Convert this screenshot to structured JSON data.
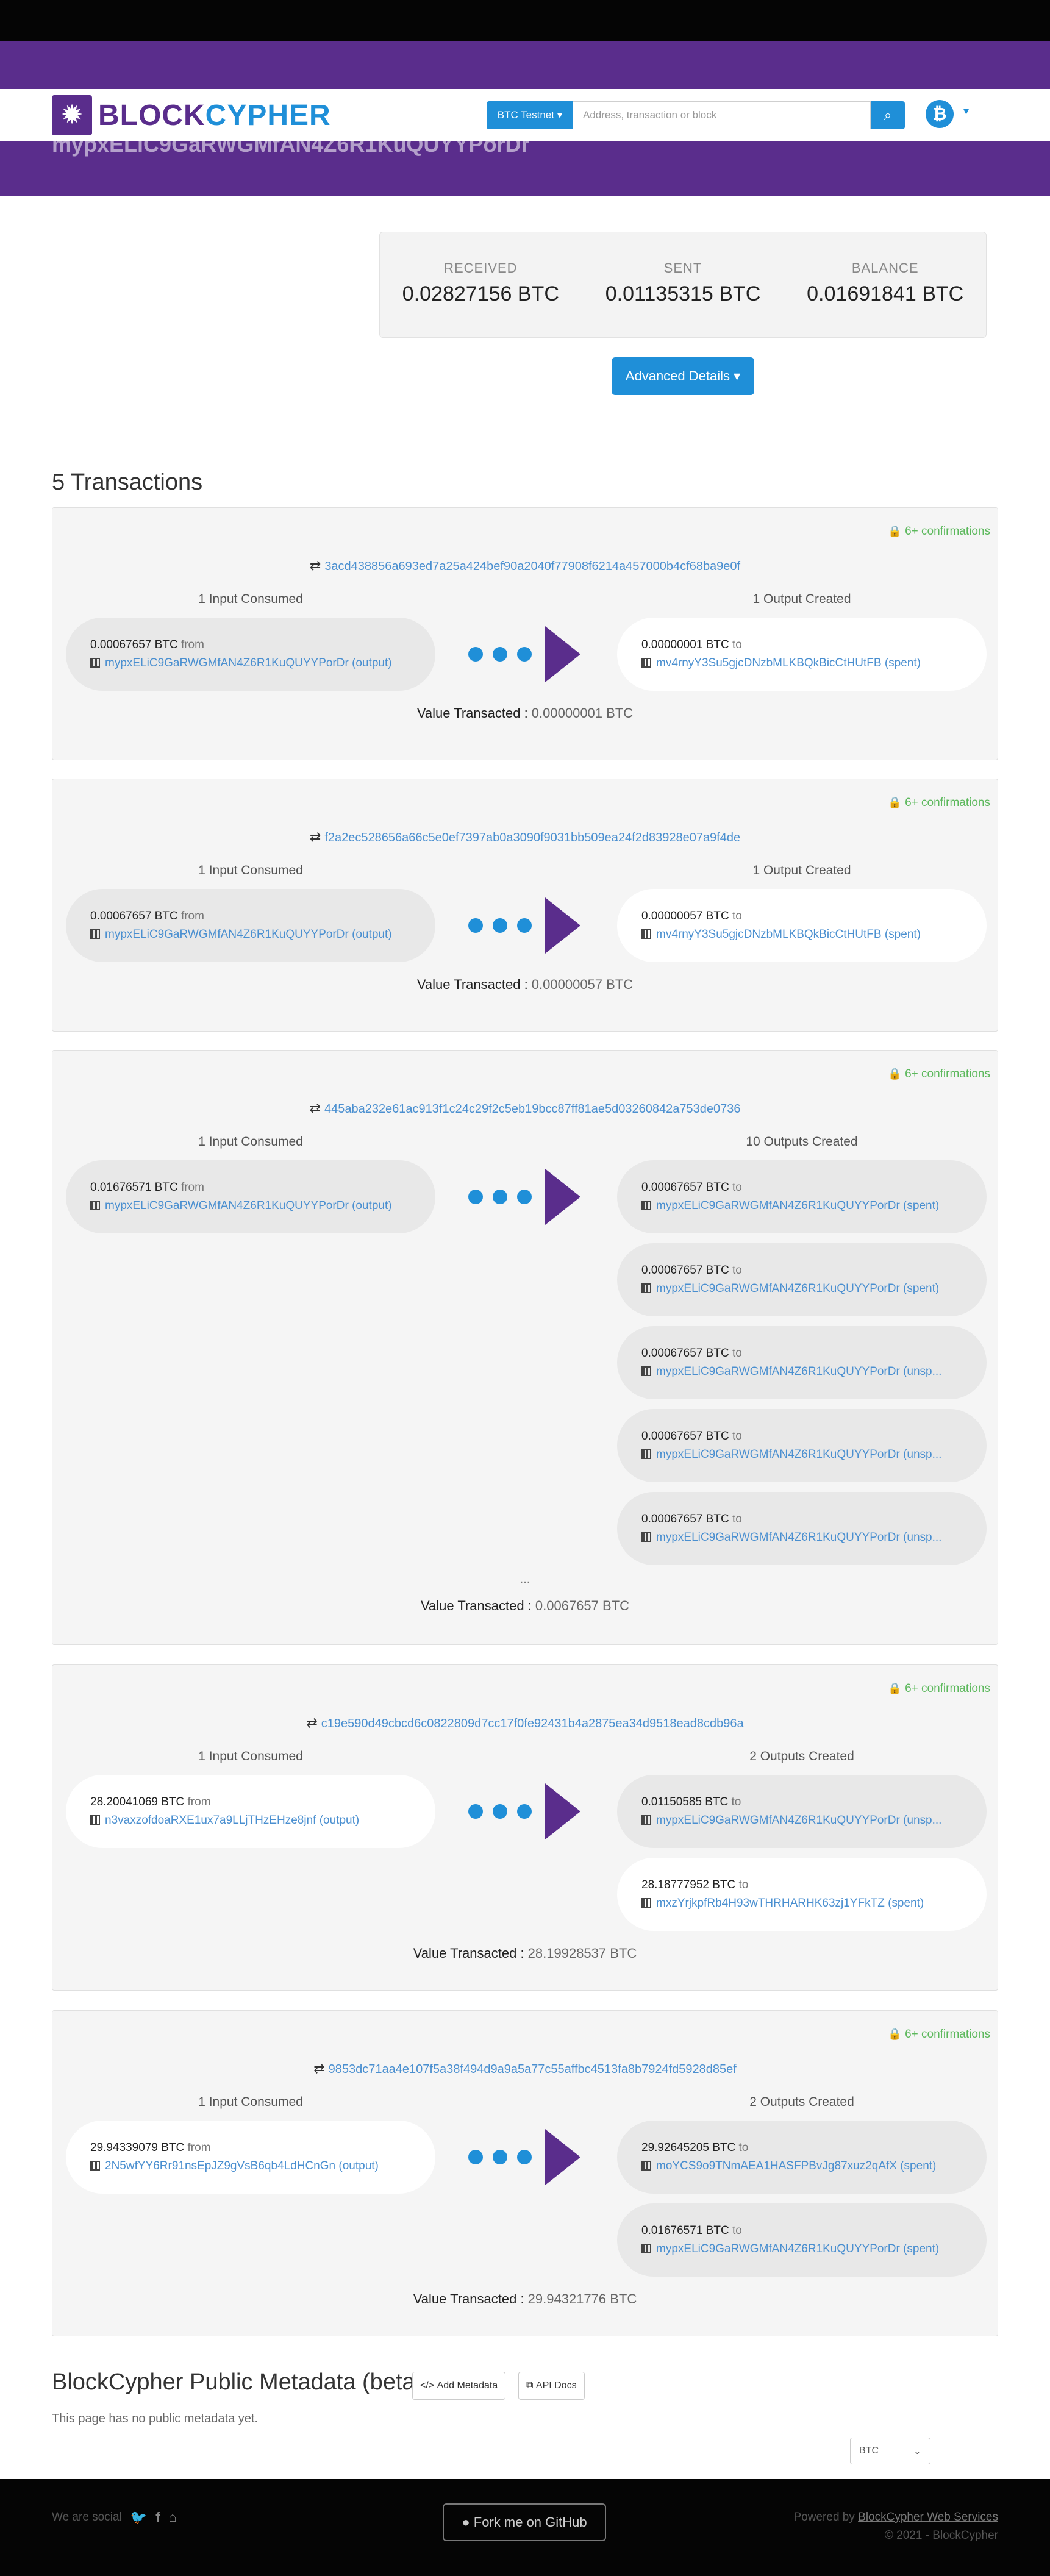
{
  "nav": {
    "logo_prefix": "BLOCK",
    "logo_accent": "CYPHER",
    "network_label": "BTC Testnet",
    "search_placeholder": "Address, transaction or block",
    "coin_symbol": "₿"
  },
  "hero": {
    "address": "mypxELiC9GaRWGMfAN4Z6R1KuQUYYPorDr"
  },
  "summary": {
    "received_label": "RECEIVED",
    "received_value": "0.02827156 BTC",
    "sent_label": "SENT",
    "sent_value": "0.01135315 BTC",
    "balance_label": "BALANCE",
    "balance_value": "0.01691841 BTC"
  },
  "advanced_button": "Advanced Details",
  "tx_heading": "5 Transactions",
  "transactions": [
    {
      "confirmations": "6+ confirmations",
      "hash": "3acd438856a693ed7a25a424bef90a2040f77908f6214a457000b4cf68ba9e0f",
      "inputs_title": "1 Input Consumed",
      "outputs_title": "1 Output Created",
      "inputs": [
        {
          "amount": "0.00067657 BTC",
          "dir": "from",
          "address": "mypxELiC9GaRWGMfAN4Z6R1KuQUYYPorDr",
          "state": "(output)"
        }
      ],
      "outputs": [
        {
          "amount": "0.00000001 BTC",
          "dir": "to",
          "address": "mv4rnyY3Su5gjcDNzbMLKBQkBicCtHUtFB",
          "state": "(spent)"
        }
      ],
      "value_label": "Value Transacted",
      "value": "0.00000001 BTC"
    },
    {
      "confirmations": "6+ confirmations",
      "hash": "f2a2ec528656a66c5e0ef7397ab0a3090f9031bb509ea24f2d83928e07a9f4de",
      "inputs_title": "1 Input Consumed",
      "outputs_title": "1 Output Created",
      "inputs": [
        {
          "amount": "0.00067657 BTC",
          "dir": "from",
          "address": "mypxELiC9GaRWGMfAN4Z6R1KuQUYYPorDr",
          "state": "(output)"
        }
      ],
      "outputs": [
        {
          "amount": "0.00000057 BTC",
          "dir": "to",
          "address": "mv4rnyY3Su5gjcDNzbMLKBQkBicCtHUtFB",
          "state": "(spent)"
        }
      ],
      "value_label": "Value Transacted",
      "value": "0.00000057 BTC"
    },
    {
      "confirmations": "6+ confirmations",
      "hash": "445aba232e61ac913f1c24c29f2c5eb19bcc87ff81ae5d03260842a753de0736",
      "inputs_title": "1 Input Consumed",
      "outputs_title": "10 Outputs Created",
      "inputs": [
        {
          "amount": "0.01676571 BTC",
          "dir": "from",
          "address": "mypxELiC9GaRWGMfAN4Z6R1KuQUYYPorDr",
          "state": "(output)"
        }
      ],
      "outputs": [
        {
          "amount": "0.00067657 BTC",
          "dir": "to",
          "address": "mypxELiC9GaRWGMfAN4Z6R1KuQUYYPorDr",
          "state": "(spent)"
        },
        {
          "amount": "0.00067657 BTC",
          "dir": "to",
          "address": "mypxELiC9GaRWGMfAN4Z6R1KuQUYYPorDr",
          "state": "(spent)"
        },
        {
          "amount": "0.00067657 BTC",
          "dir": "to",
          "address": "mypxELiC9GaRWGMfAN4Z6R1KuQUYYPorDr",
          "state": "(unsp..."
        },
        {
          "amount": "0.00067657 BTC",
          "dir": "to",
          "address": "mypxELiC9GaRWGMfAN4Z6R1KuQUYYPorDr",
          "state": "(unsp..."
        },
        {
          "amount": "0.00067657 BTC",
          "dir": "to",
          "address": "mypxELiC9GaRWGMfAN4Z6R1KuQUYYPorDr",
          "state": "(unsp..."
        }
      ],
      "more_marker": "...",
      "value_label": "Value Transacted",
      "value": "0.0067657 BTC"
    },
    {
      "confirmations": "6+ confirmations",
      "hash": "c19e590d49cbcd6c0822809d7cc17f0fe92431b4a2875ea34d9518ead8cdb96a",
      "inputs_title": "1 Input Consumed",
      "outputs_title": "2 Outputs Created",
      "inputs": [
        {
          "amount": "28.20041069 BTC",
          "dir": "from",
          "address": "n3vaxzofdoaRXE1ux7a9LLjTHzEHze8jnf",
          "state": "(output)"
        }
      ],
      "outputs": [
        {
          "amount": "0.01150585 BTC",
          "dir": "to",
          "address": "mypxELiC9GaRWGMfAN4Z6R1KuQUYYPorDr",
          "state": "(unsp..."
        },
        {
          "amount": "28.18777952 BTC",
          "dir": "to",
          "address": "mxzYrjkpfRb4H93wTHRHARHK63zj1YFkTZ",
          "state": "(spent)"
        }
      ],
      "value_label": "Value Transacted",
      "value": "28.19928537 BTC"
    },
    {
      "confirmations": "6+ confirmations",
      "hash": "9853dc71aa4e107f5a38f494d9a9a5a77c55affbc4513fa8b7924fd5928d85ef",
      "inputs_title": "1 Input Consumed",
      "outputs_title": "2 Outputs Created",
      "inputs": [
        {
          "amount": "29.94339079 BTC",
          "dir": "from",
          "address": "2N5wfYY6Rr91nsEpJZ9gVsB6qb4LdHCnGn",
          "state": "(output)"
        }
      ],
      "outputs": [
        {
          "amount": "29.92645205 BTC",
          "dir": "to",
          "address": "moYCS9o9TNmAEA1HASFPBvJg87xuz2qAfX",
          "state": "(spent)"
        },
        {
          "amount": "0.01676571 BTC",
          "dir": "to",
          "address": "mypxELiC9GaRWGMfAN4Z6R1KuQUYYPorDr",
          "state": "(spent)"
        }
      ],
      "value_label": "Value Transacted",
      "value": "29.94321776 BTC"
    }
  ],
  "metadata": {
    "title": "BlockCypher Public Metadata (beta)",
    "add_button": "Add Metadata",
    "api_button": "API Docs",
    "empty_text": "This page has no public metadata yet."
  },
  "currency_select": "BTC",
  "footer": {
    "social_label": "We are social",
    "fork_label": "Fork me on GitHub",
    "powered_prefix": "Powered by",
    "powered_link": "BlockCypher Web Services",
    "copyright": "© 2021 - BlockCypher"
  },
  "colors": {
    "brand_purple": "#5a2d8c",
    "accent_blue": "#1f8fd8",
    "confirm_green": "#5cb85c"
  }
}
